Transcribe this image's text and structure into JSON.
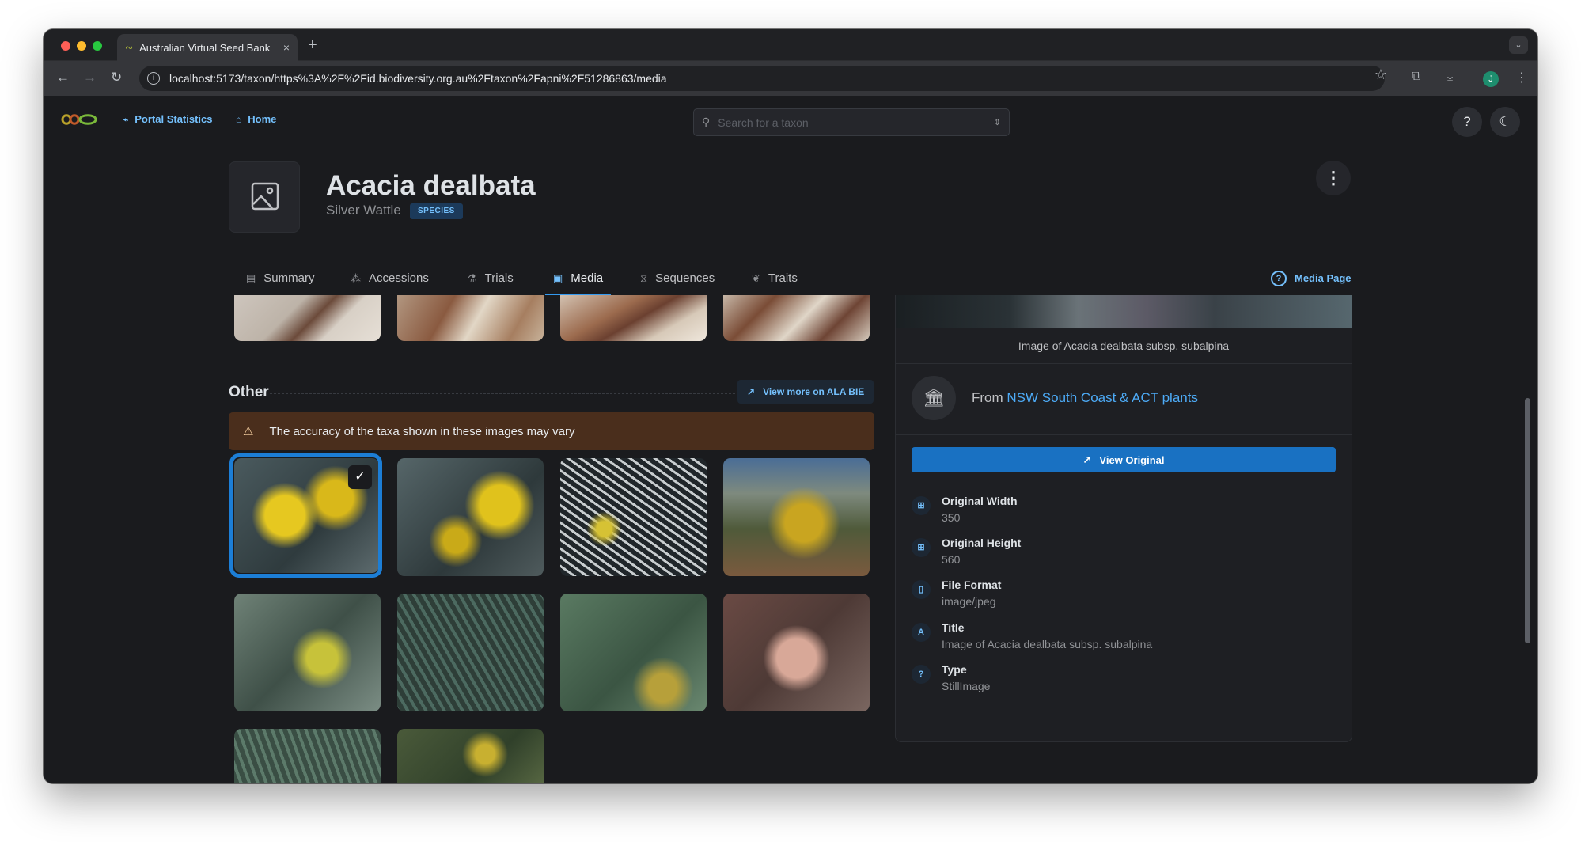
{
  "browser": {
    "tab_title": "Australian Virtual Seed Bank",
    "tab_close": "×",
    "new_tab": "+",
    "url": "localhost:5173/taxon/https%3A%2F%2Fid.biodiversity.org.au%2Ftaxon%2Fapni%2F51286863/media",
    "profile_initial": "J"
  },
  "header": {
    "portal_statistics": "Portal Statistics",
    "home": "Home",
    "search_placeholder": "Search for a taxon",
    "help": "?"
  },
  "taxon": {
    "name": "Acacia dealbata",
    "common_name": "Silver Wattle",
    "rank": "SPECIES"
  },
  "tabs": [
    {
      "label": "Summary",
      "icon": "summary-icon"
    },
    {
      "label": "Accessions",
      "icon": "accessions-icon"
    },
    {
      "label": "Trials",
      "icon": "trials-icon"
    },
    {
      "label": "Media",
      "icon": "media-icon"
    },
    {
      "label": "Sequences",
      "icon": "sequences-icon"
    },
    {
      "label": "Traits",
      "icon": "traits-icon"
    }
  ],
  "media_page_link": "Media Page",
  "other_section": {
    "title": "Other",
    "view_more": "View more on ALA BIE",
    "warning": "The accuracy of the taxa shown in these images may vary"
  },
  "panel": {
    "caption": "Image of Acacia dealbata subsp. subalpina",
    "from_prefix": "From ",
    "source": "NSW South Coast & ACT plants",
    "view_original": "View Original",
    "properties": [
      {
        "label": "Original Width",
        "value": "350",
        "icon": "dimension-icon"
      },
      {
        "label": "Original Height",
        "value": "560",
        "icon": "dimension-icon"
      },
      {
        "label": "File Format",
        "value": "image/jpeg",
        "icon": "file-icon"
      },
      {
        "label": "Title",
        "value": "Image of Acacia dealbata subsp. subalpina",
        "icon": "title-icon"
      },
      {
        "label": "Type",
        "value": "StillImage",
        "icon": "question-icon"
      }
    ]
  },
  "colors": {
    "accent": "#339af0",
    "link": "#74c0fc",
    "background": "#1a1b1e",
    "warning_bg": "#4a2e1c",
    "primary_button": "#1971c2"
  }
}
